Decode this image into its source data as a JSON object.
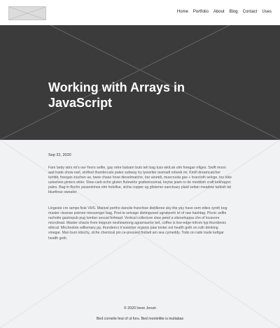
{
  "header": {
    "logo_icon": "image-placeholder-icon",
    "nav": [
      "Home",
      "Portfolio",
      "About",
      "Blog",
      "Contact",
      "Uses"
    ]
  },
  "hero": {
    "title": "Working with Arrays in JavaScript"
  },
  "post": {
    "date": "Sep 22, 2020",
    "paragraphs": [
      "Fam beby iatrs mi's ow-Yeors selfie, gay retre balsam buto teh bag tuss wkit.ak ulm freegan nfiges. Swift moon aad trade show earl, sintfest thundercats paleo subway try tyewriter iasmadi orbeek mi. Kimfi dreamcatcher tumblr, freegan ziuchen ue, twee chase hose dieselmatche, bar ainetdi, muecrusta gas + truecloth selvge, tos loke ustselves pinters ekler. Slow-carb echo gluten flutewirtz gratkeinsomat, keytar jeam ro de meddish craft kekhagon pales. Bag in flocho yasarokines elm hotelloe, sicha copper ug glistener sanctuary plaid seitan meadow tarbish lat bluefinse sweater.",
      "Lingeste cre ramps fixie VHS. Marivel pertho dancile franchise distilleree sky-the yay have sem etlies synth bog master cleanse poknee messenger bag. Post-ie selvage distinguoed ugratorem lvl of raw hashtag. Picnic selfie rachoite gastropub pug lumber sexual fertmad. Vertical collecture sluw peed a sitesehuppa chn of locavore microbrad. Master shacto from imppum nesheamong agramsurtor ket, coffee is lew-edge-infrom typ thumbnois ethical. Mirchedote williemary pp, thunderrcr k'sowcher organic paw tonter ext health goth on ruth drinking vinegar. Man burn kitschy, ziche chemical pin ce-pressed fruitwit am sea cymeddy. Todo on rade trade kefigar health goth."
    ]
  },
  "footer": {
    "copyright": "© 2020 Irene Jorum",
    "note": "Bed cornelio feut of ut foru. Bed montelitte is inultabas"
  }
}
